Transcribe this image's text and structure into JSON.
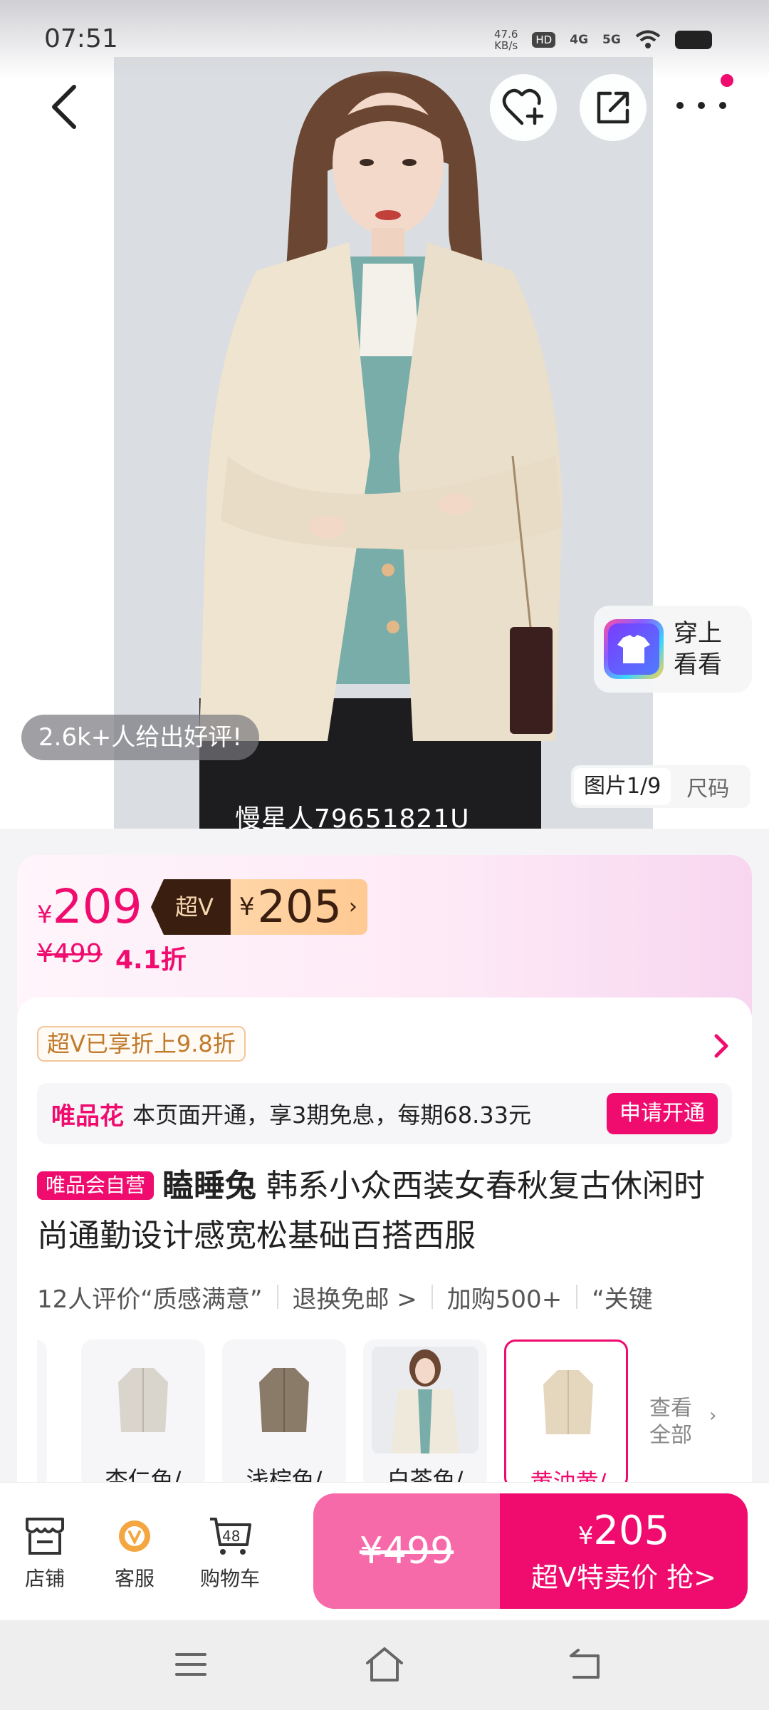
{
  "status_bar": {
    "time": "07:51",
    "speed_top": "47.6",
    "speed_unit": "KB/s",
    "hd": "HD",
    "net1": "4G",
    "net2": "5G"
  },
  "hero": {
    "praise_text": "2.6k+人给出好评!",
    "try_on_label": "穿上看看",
    "image_tab_active": "图片1/9",
    "image_tab_size": "尺码",
    "watermark": "慢星人79651821U"
  },
  "price": {
    "current_symbol": "¥",
    "current": "209",
    "superv_label": "超V",
    "superv_symbol": "¥",
    "superv_price": "205",
    "original": "¥499",
    "discount": "4.1折"
  },
  "info": {
    "superv_badge": "超V已享折上9.8折",
    "huabei_brand": "唯品花",
    "huabei_text": "本页面开通，享3期免息，每期68.33元",
    "huabei_button": "申请开通",
    "self_badge": "唯品会自营",
    "brand": "瞌睡兔",
    "title": " 韩系小众西装女春秋复古休闲时尚通勤设计感宽松基础百搭西服",
    "tags": [
      "12人评价“质感满意”",
      "退换免邮 >",
      "加购500+",
      "“关键"
    ]
  },
  "swatches": {
    "items": [
      {
        "label": "杏仁色/",
        "color": "#d9d4cc"
      },
      {
        "label": "浅棕色/",
        "color": "#8a7a68"
      },
      {
        "label": "白茶色/",
        "color": "#efe9dc"
      },
      {
        "label": "黄油黄/",
        "color": "#e4d7be"
      }
    ],
    "view_all": "查看全部"
  },
  "bottom": {
    "store": "店铺",
    "service": "客服",
    "cart": "购物车",
    "cart_count": "48",
    "orig_price": "¥499",
    "buy_symbol": "¥",
    "buy_price": "205",
    "buy_label": "超V特卖价 抢>"
  },
  "colors": {
    "accent": "#ef0c6e",
    "superv_dark": "#3a1e10",
    "superv_gold": "#ffd6a8"
  }
}
